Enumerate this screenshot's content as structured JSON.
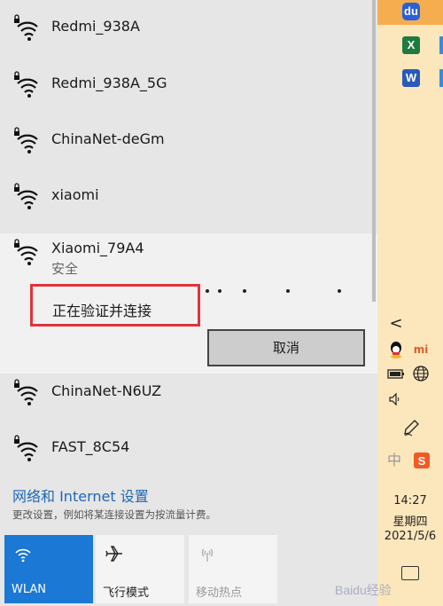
{
  "networks_top": [
    {
      "ssid": "Redmi_938A",
      "secured": true
    },
    {
      "ssid": "Redmi_938A_5G",
      "secured": true
    },
    {
      "ssid": "ChinaNet-deGm",
      "secured": true
    },
    {
      "ssid": "xiaomi",
      "secured": true
    }
  ],
  "expanded_network": {
    "ssid": "Xiaomi_79A4",
    "security": "安全",
    "status": "正在验证并连接",
    "cancel_label": "取消"
  },
  "networks_bottom": [
    {
      "ssid": "ChinaNet-N6UZ",
      "secured": true
    },
    {
      "ssid": "FAST_8C54",
      "secured": true
    }
  ],
  "settings": {
    "link": "网络和 Internet 设置",
    "description": "更改设置，例如将某连接设置为按流量计费。"
  },
  "quick_actions": [
    {
      "label": "WLAN",
      "icon": "wifi-icon",
      "active": true
    },
    {
      "label": "飞行模式",
      "icon": "airplane-icon",
      "active": false
    },
    {
      "label": "移动热点",
      "icon": "hotspot-icon",
      "active": false
    }
  ],
  "taskbar": {
    "apps": [
      {
        "icon": "baidu-icon",
        "text": "du"
      },
      {
        "icon": "excel-icon",
        "text": "X"
      },
      {
        "icon": "word-icon",
        "text": "W"
      }
    ],
    "tray_chevron": "<",
    "ime_mode": "中",
    "clock": {
      "time": "14:27",
      "day": "星期四",
      "date": "2021/5/6"
    }
  },
  "watermark": "Baidu经验",
  "colors": {
    "accent": "#1b78d4",
    "highlight_box": "#e0323a",
    "taskbar": "#fce7bc",
    "link": "#1f66b8"
  }
}
